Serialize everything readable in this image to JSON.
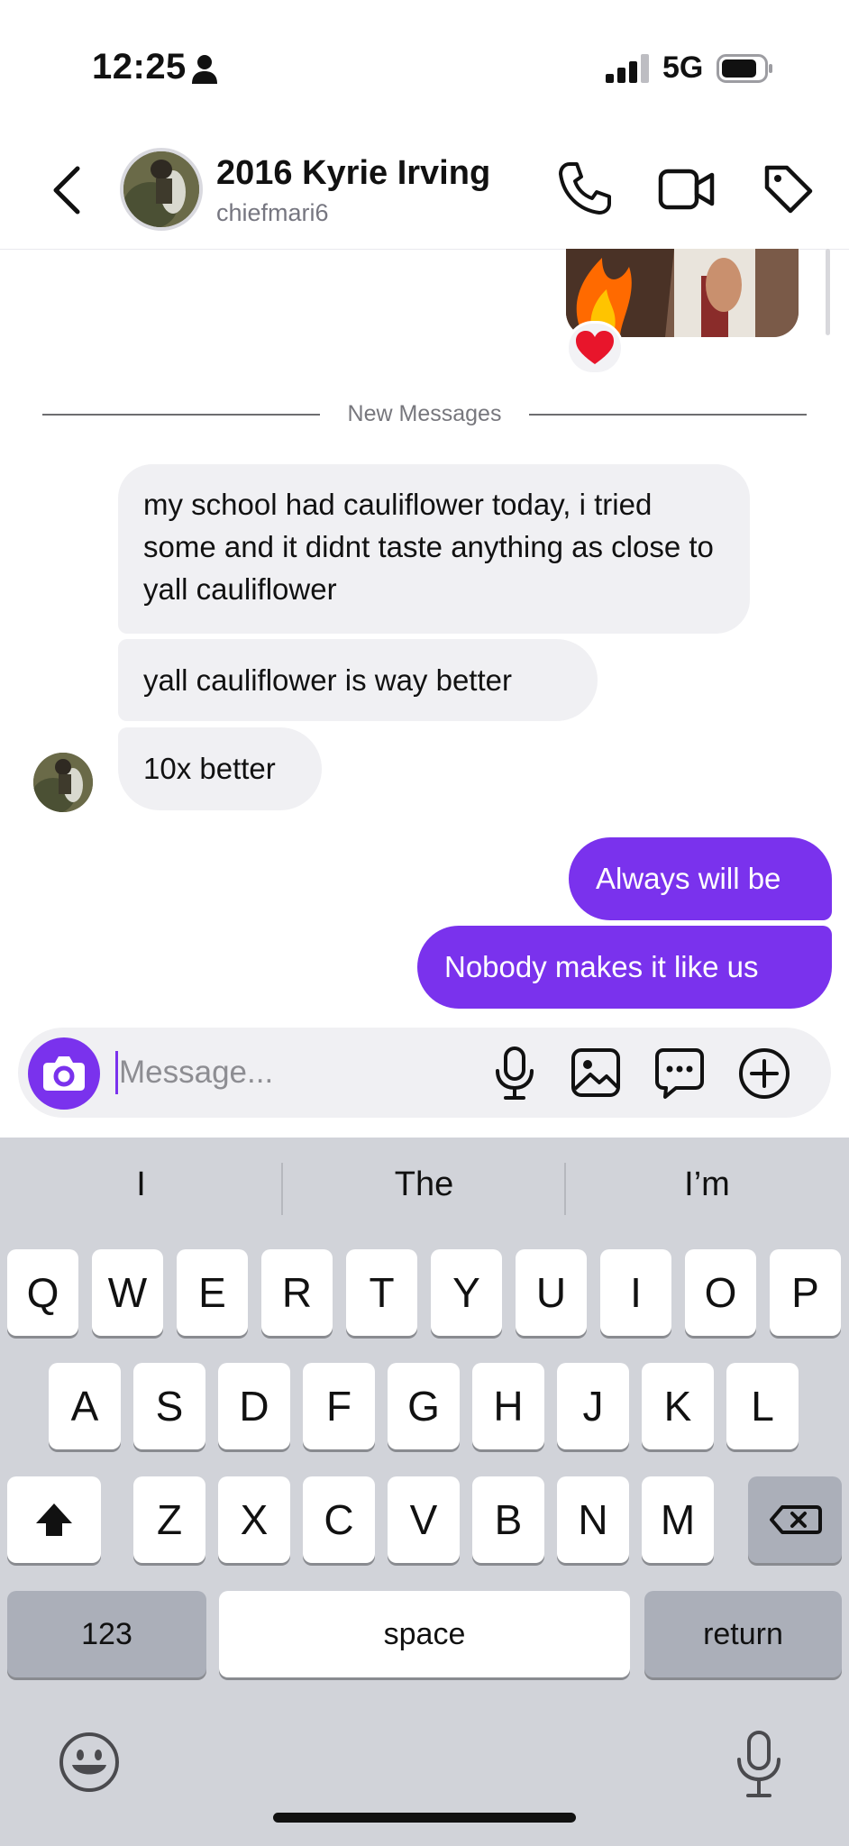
{
  "status_bar": {
    "time": "12:25",
    "network": "5G",
    "icons": [
      "person-icon",
      "signal-icon",
      "battery-icon"
    ]
  },
  "header": {
    "name": "2016 Kyrie Irving",
    "username": "chiefmari6",
    "icons": [
      "back-chevron-icon",
      "phone-icon",
      "video-camera-icon",
      "tag-icon"
    ]
  },
  "conversation": {
    "reaction_icon": "heart-icon",
    "divider_text": "New Messages",
    "incoming": [
      "my school had cauliflower today, i tried some and it didnt taste anything as close to yall cauliflower",
      "yall cauliflower is way better",
      "10x better"
    ],
    "outgoing": [
      "Always will be",
      "Nobody makes it like us"
    ]
  },
  "composer": {
    "placeholder": "Message...",
    "value": "",
    "icons": [
      "camera-icon",
      "microphone-icon",
      "photo-icon",
      "sticker-icon",
      "plus-circle-icon"
    ]
  },
  "keyboard": {
    "suggestions": [
      "I",
      "The",
      "I’m"
    ],
    "row1": [
      "Q",
      "W",
      "E",
      "R",
      "T",
      "Y",
      "U",
      "I",
      "O",
      "P"
    ],
    "row2": [
      "A",
      "S",
      "D",
      "F",
      "G",
      "H",
      "J",
      "K",
      "L"
    ],
    "row3": [
      "Z",
      "X",
      "C",
      "V",
      "B",
      "N",
      "M"
    ],
    "numbers_label": "123",
    "space_label": "space",
    "return_label": "return"
  },
  "colors": {
    "accent": "#7a32ed",
    "incoming_bubble": "#f0f0f3",
    "keyboard_bg": "#d1d3d9"
  }
}
